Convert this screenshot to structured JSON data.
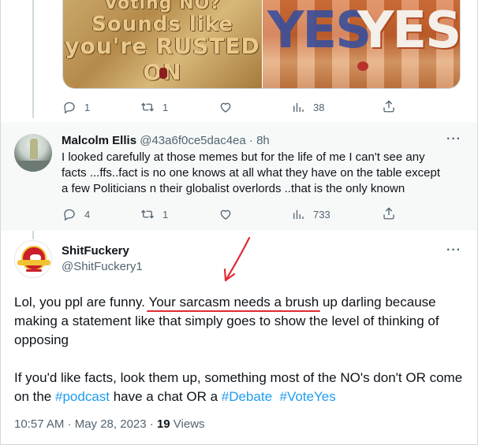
{
  "top_tweet": {
    "media": {
      "left_image_text": [
        "Voting NO?",
        "Sounds like",
        "you're RUSTED ON"
      ],
      "right_image_text": [
        "YES",
        "YES"
      ]
    },
    "actions": {
      "replies": "1",
      "retweets": "1",
      "likes": "",
      "views": "38"
    }
  },
  "reply": {
    "name": "Malcolm Ellis",
    "handle": "@43a6f0ce5dac4ea",
    "time": "· 8h",
    "text_lines": [
      "I looked carefully at those memes but for the life of me I can't see any",
      "facts ...ffs..fact is no one knows at all what they have on the table except",
      "a few Politicians n their globalist overlords ..that is the only known"
    ],
    "actions": {
      "replies": "4",
      "retweets": "1",
      "likes": "",
      "views": "733"
    }
  },
  "main_tweet": {
    "name": "ShitFuckery",
    "handle": "@ShitFuckery1",
    "p1_before": "Lol, you ppl are funny. ",
    "p1_highlight": "Your sarcasm needs a brush",
    "p1_after": " up darling because making a statement like that simply goes to show the level of thinking of opposing",
    "p2_text1": "If you'd like facts, look them up, something most of the NO's don't OR come on the ",
    "p2_tag1": "#podcast",
    "p2_text2": " have a chat OR a ",
    "p2_tag2": "#Debate",
    "p2_space": "  ",
    "p2_tag3": "#VoteYes",
    "timestamp": "10:57 AM · May 28, 2023 · ",
    "views_count": "19",
    "views_label": " Views"
  },
  "more_label": "···",
  "colors": {
    "link": "#1d9bf0",
    "annotation": "#e02b35",
    "muted": "#536471",
    "text": "#0f1419"
  },
  "icons": [
    "reply-icon",
    "retweet-icon",
    "like-icon",
    "views-icon",
    "share-icon",
    "more-icon"
  ]
}
